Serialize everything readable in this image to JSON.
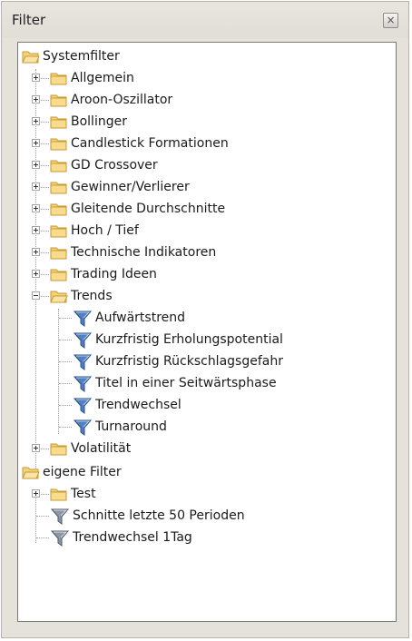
{
  "window": {
    "title": "Filter",
    "close_glyph": "×"
  },
  "tree": {
    "root1": "Systemfilter",
    "allgemein": "Allgemein",
    "aroon": "Aroon-Oszillator",
    "bollinger": "Bollinger",
    "candlestick": "Candlestick Formationen",
    "gd_crossover": "GD Crossover",
    "gewinner": "Gewinner/Verlierer",
    "gleitende": "Gleitende Durchschnitte",
    "hoch_tief": "Hoch / Tief",
    "technische": "Technische Indikatoren",
    "trading_ideen": "Trading Ideen",
    "trends": "Trends",
    "trends_children": {
      "aufwaerts": "Aufwärtstrend",
      "erholung": "Kurzfristig Erholungspotential",
      "rueckschlag": "Kurzfristig Rückschlagsgefahr",
      "seitwaerts": "Titel in einer Seitwärtsphase",
      "trendwechsel": "Trendwechsel",
      "turnaround": "Turnaround"
    },
    "volatilitaet": "Volatilität",
    "root2": "eigene Filter",
    "test": "Test",
    "schnitte": "Schnitte letzte 50 Perioden",
    "trendwechsel_1tag": "Trendwechsel 1Tag"
  },
  "icons": {
    "folder": "folder-icon",
    "folder_open": "folder-open-icon",
    "filter": "filter-funnel-icon"
  },
  "colors": {
    "folder_fill": "#f3d27a",
    "folder_edge": "#c79a36",
    "filter_blue": "#4f7fc0",
    "filter_grey": "#8a95a5"
  }
}
